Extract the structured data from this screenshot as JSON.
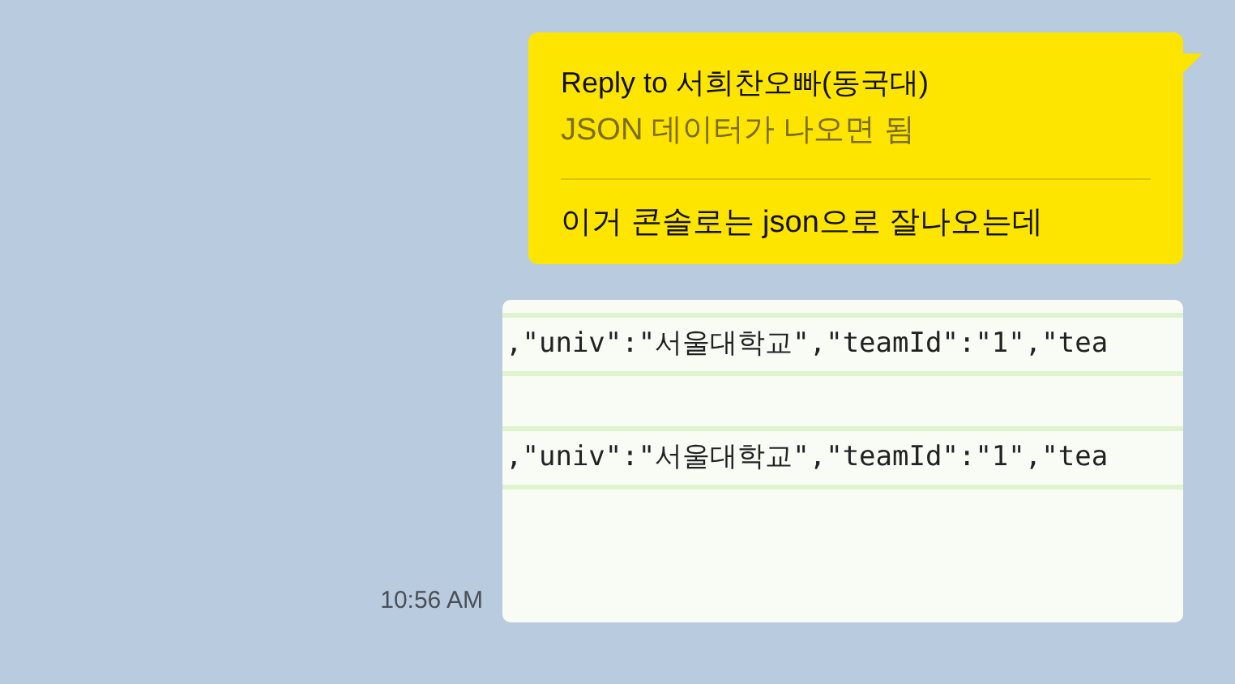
{
  "messages": [
    {
      "kind": "reply",
      "reply_to": "Reply to 서희찬오빠(동국대)",
      "quoted": "JSON 데이터가 나오면 됨",
      "text": "이거 콘솔로는 json으로 잘나오는데"
    },
    {
      "kind": "image",
      "time": "10:56 AM",
      "code_lines": [
        ",\"univ\":\"서울대학교\",\"teamId\":\"1\",\"tea",
        ",\"univ\":\"서울대학교\",\"teamId\":\"1\",\"tea"
      ]
    }
  ]
}
